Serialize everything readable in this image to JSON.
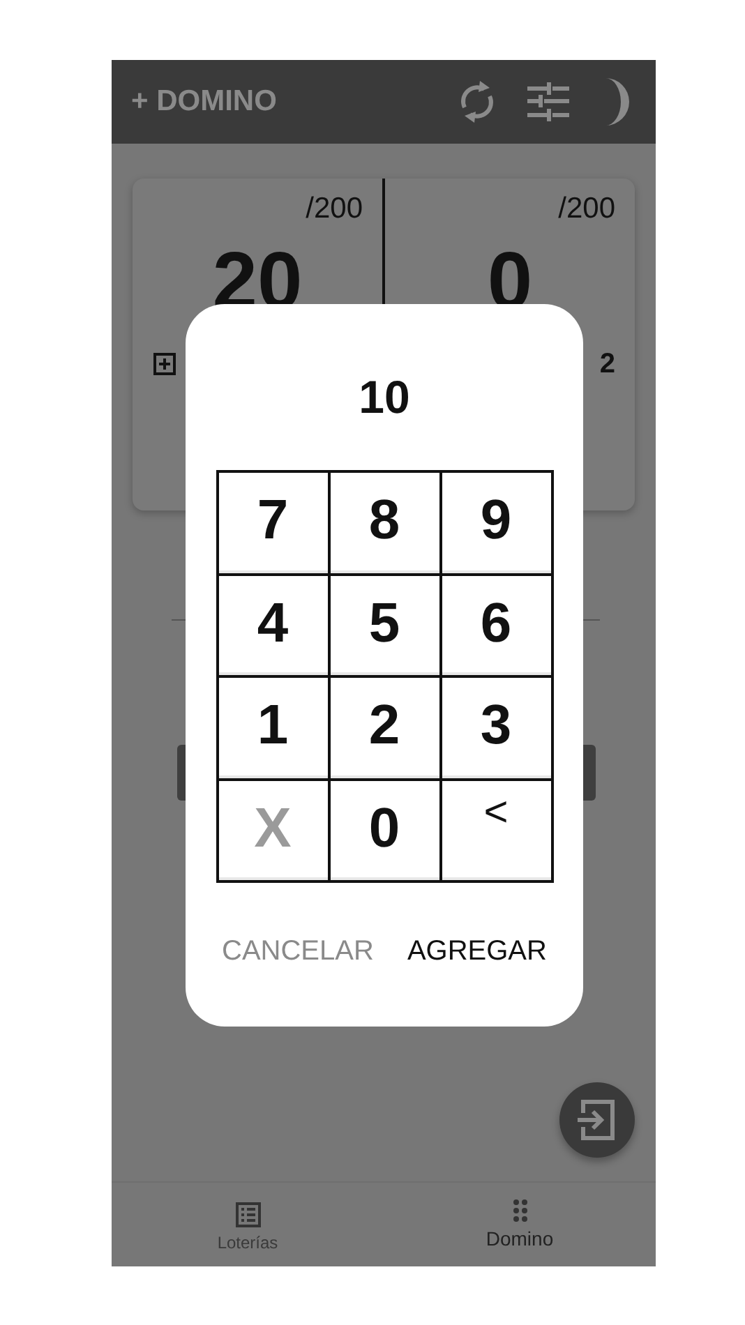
{
  "app_bar": {
    "title": "+ DOMINO"
  },
  "score_panel": {
    "teams": [
      {
        "goal": "/200",
        "score": "20"
      },
      {
        "goal": "/200",
        "score": "0",
        "footer": "2"
      }
    ]
  },
  "dialog": {
    "value": "10",
    "keys": [
      {
        "label": "7",
        "kind": "digit"
      },
      {
        "label": "8",
        "kind": "digit"
      },
      {
        "label": "9",
        "kind": "digit"
      },
      {
        "label": "4",
        "kind": "digit"
      },
      {
        "label": "5",
        "kind": "digit"
      },
      {
        "label": "6",
        "kind": "digit"
      },
      {
        "label": "1",
        "kind": "digit"
      },
      {
        "label": "2",
        "kind": "digit"
      },
      {
        "label": "3",
        "kind": "digit"
      },
      {
        "label": "X",
        "kind": "clear"
      },
      {
        "label": "0",
        "kind": "digit"
      },
      {
        "label": "<",
        "kind": "backspace"
      }
    ],
    "actions": [
      {
        "label": "CANCELAR",
        "kind": "secondary"
      },
      {
        "label": "AGREGAR",
        "kind": "primary"
      }
    ]
  },
  "bottom_nav": [
    {
      "label": "Loterías",
      "selected": false
    },
    {
      "label": "Domino",
      "selected": true
    }
  ]
}
